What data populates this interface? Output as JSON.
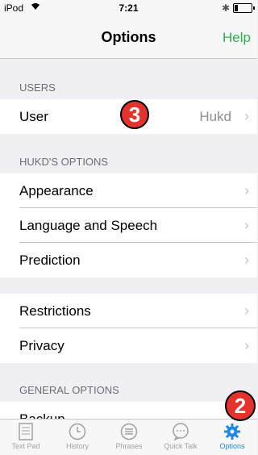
{
  "status": {
    "carrier": "iPod",
    "time": "7:21"
  },
  "nav": {
    "title": "Options",
    "help": "Help"
  },
  "sections": {
    "users_header": "USERS",
    "hukd_header": "HUKD'S OPTIONS",
    "general_header": "GENERAL OPTIONS"
  },
  "rows": {
    "user": {
      "label": "User",
      "value": "Hukd"
    },
    "appearance": {
      "label": "Appearance"
    },
    "language": {
      "label": "Language and Speech"
    },
    "prediction": {
      "label": "Prediction"
    },
    "restrictions": {
      "label": "Restrictions"
    },
    "privacy": {
      "label": "Privacy"
    },
    "backup": {
      "label": "Backup"
    }
  },
  "badges": {
    "user_badge": "3",
    "tab_badge": "2"
  },
  "tabs": [
    {
      "label": "Text Pad",
      "icon": "document-icon"
    },
    {
      "label": "History",
      "icon": "clock-icon"
    },
    {
      "label": "Phrases",
      "icon": "list-icon"
    },
    {
      "label": "Quick Talk",
      "icon": "speech-bubble-icon"
    },
    {
      "label": "Options",
      "icon": "gear-icon",
      "active": true
    }
  ],
  "colors": {
    "accent_green": "#2bb24c",
    "active_tab": "#1e88e5",
    "badge_red": "#e5322d"
  }
}
